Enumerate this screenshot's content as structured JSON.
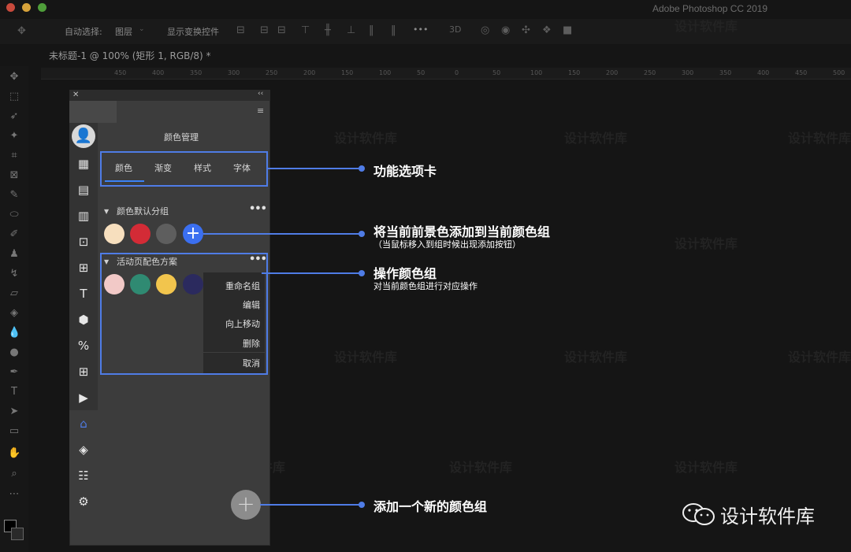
{
  "app": {
    "title": "Adobe Photoshop CC 2019"
  },
  "options_bar": {
    "auto_select": "自动选择:",
    "layer_select": "图层",
    "show_transform": "显示变换控件",
    "more": "•••"
  },
  "document": {
    "tab": "未标题-1 @ 100% (矩形 1, RGB/8) *"
  },
  "ruler": {
    "ticks": [
      "450",
      "400",
      "350",
      "300",
      "250",
      "200",
      "150",
      "100",
      "50",
      "0",
      "50",
      "100",
      "150",
      "200",
      "250",
      "300",
      "350",
      "400",
      "450",
      "500"
    ]
  },
  "watermark": "设计软件库",
  "panel": {
    "title": "颜色管理",
    "tabs": [
      "颜色",
      "渐变",
      "样式",
      "字体"
    ],
    "group1": {
      "label": "颜色默认分组",
      "swatches": [
        "#f7dfbe",
        "#d32b36",
        "#5e5e5e"
      ],
      "add_symbol": "+"
    },
    "group2": {
      "label": "活动页配色方案",
      "swatches": [
        "#f2c9c7",
        "#2f8a72",
        "#f2c54d",
        "#2b2a5e"
      ]
    },
    "menu": [
      "重命名组",
      "编辑",
      "向上移动",
      "删除",
      "取消"
    ],
    "more": "•••",
    "fab_symbol": "+"
  },
  "callouts": {
    "tabs": "功能选项卡",
    "add_color": "将当前前景色添加到当前颜色组",
    "add_color_sub": "（当鼠标移入到组时候出现添加按钮）",
    "operate": "操作颜色组",
    "operate_sub": "对当前颜色组进行对应操作",
    "new_group": "添加一个新的颜色组"
  },
  "brand": "设计软件库",
  "colors": {
    "accent": "#4f7ce6",
    "panel_bg": "#3c3c3c",
    "canvas_bg": "#151515"
  }
}
